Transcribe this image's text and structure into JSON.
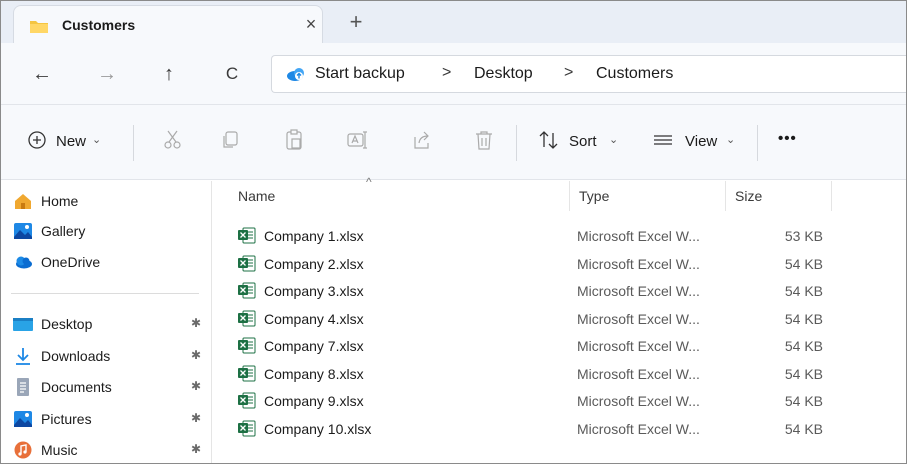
{
  "tab": {
    "title": "Customers",
    "close": "×",
    "new_tab": "+"
  },
  "nav": {
    "back": "←",
    "forward": "→",
    "up": "↑",
    "refresh": "C"
  },
  "address": {
    "crumbs": [
      "Start backup",
      "Desktop",
      "Customers"
    ],
    "separator": ">"
  },
  "toolbar": {
    "new_label": "New",
    "sort_label": "Sort",
    "view_label": "View",
    "more": "•••",
    "chevron": "⌄"
  },
  "sidebar": {
    "items": [
      {
        "label": "Home",
        "icon": "home-icon"
      },
      {
        "label": "Gallery",
        "icon": "gallery-icon"
      },
      {
        "label": "OneDrive",
        "icon": "onedrive-icon"
      },
      {
        "label": "Desktop",
        "icon": "desktop-icon",
        "pinned": true
      },
      {
        "label": "Downloads",
        "icon": "download-icon",
        "pinned": true
      },
      {
        "label": "Documents",
        "icon": "documents-icon",
        "pinned": true
      },
      {
        "label": "Pictures",
        "icon": "pictures-icon",
        "pinned": true
      },
      {
        "label": "Music",
        "icon": "music-icon",
        "pinned": true
      }
    ],
    "pin_glyph": "✱"
  },
  "files": {
    "columns": {
      "name": "Name",
      "type": "Type",
      "size": "Size"
    },
    "rows": [
      {
        "name": "Company 1.xlsx",
        "type": "Microsoft Excel W...",
        "size": "53 KB"
      },
      {
        "name": "Company 2.xlsx",
        "type": "Microsoft Excel W...",
        "size": "54 KB"
      },
      {
        "name": "Company 3.xlsx",
        "type": "Microsoft Excel W...",
        "size": "54 KB"
      },
      {
        "name": "Company 4.xlsx",
        "type": "Microsoft Excel W...",
        "size": "54 KB"
      },
      {
        "name": "Company 7.xlsx",
        "type": "Microsoft Excel W...",
        "size": "54 KB"
      },
      {
        "name": "Company 8.xlsx",
        "type": "Microsoft Excel W...",
        "size": "54 KB"
      },
      {
        "name": "Company 9.xlsx",
        "type": "Microsoft Excel W...",
        "size": "54 KB"
      },
      {
        "name": "Company 10.xlsx",
        "type": "Microsoft Excel W...",
        "size": "54 KB"
      }
    ]
  },
  "colors": {
    "accent": "#0067c0",
    "excel": "#1d7044",
    "folder": "#f4c542"
  }
}
